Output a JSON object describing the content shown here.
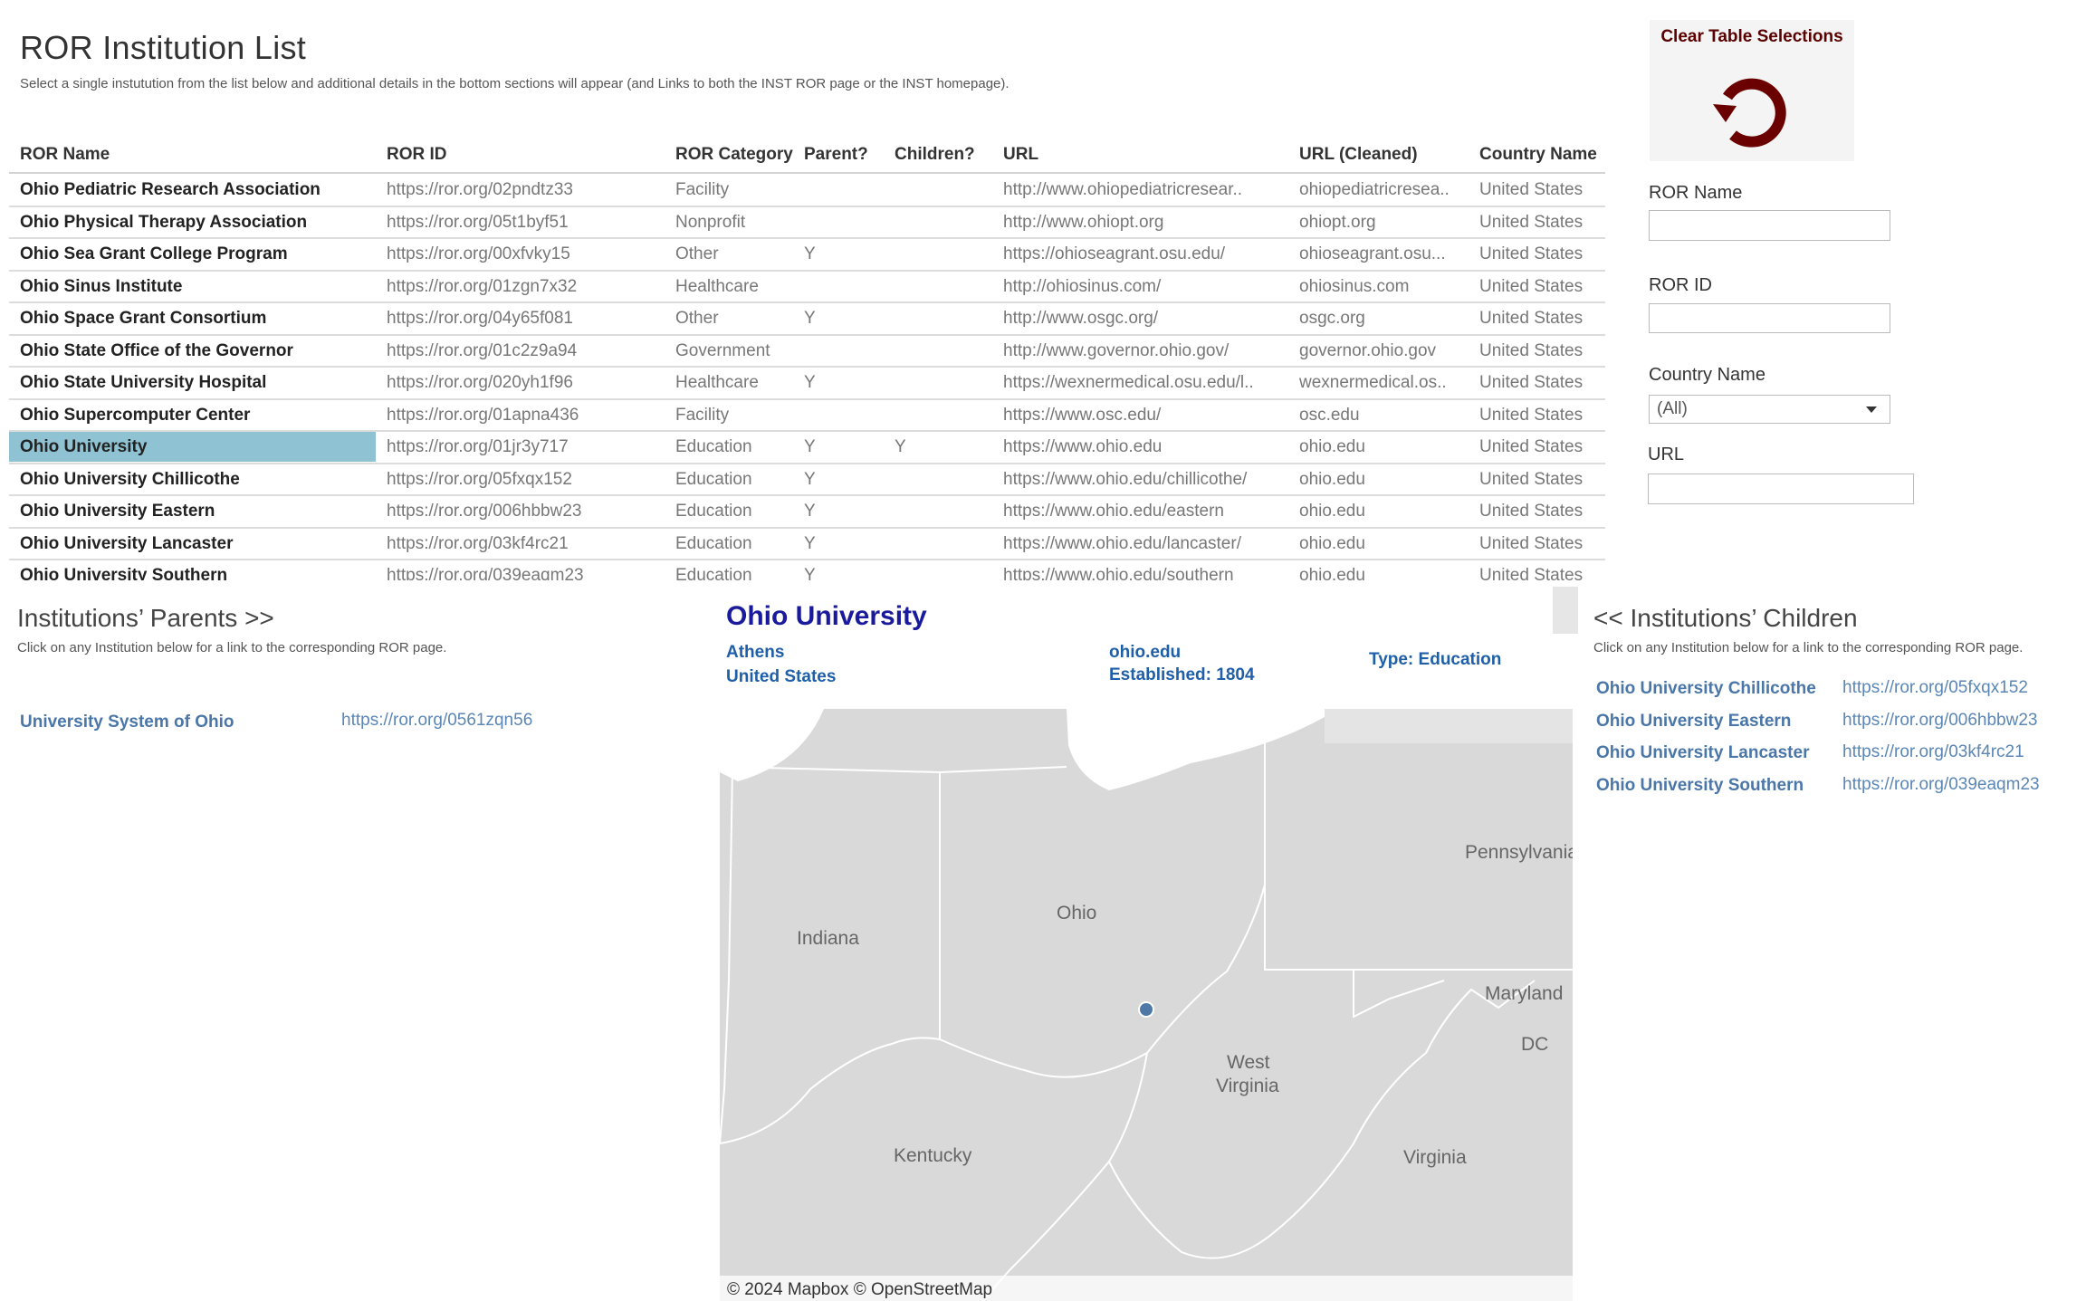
{
  "header": {
    "title": "ROR Institution List",
    "subtitle": "Select a single instutution from the list below and additional details in the bottom sections will appear (and Links to both the INST ROR page or the INST homepage)."
  },
  "table": {
    "columns": [
      "ROR Name",
      "ROR ID",
      "ROR Category",
      "Parent?",
      "Children?",
      "URL",
      "URL (Cleaned)",
      "Country Name"
    ],
    "selected_row": 8,
    "selected_color": "#8fc3d3",
    "rows": [
      [
        "Ohio Pediatric Research Association",
        "https://ror.org/02pndtz33",
        "Facility",
        "",
        "",
        "http://www.ohiopediatricresear..",
        "ohiopediatricresea..",
        "United States"
      ],
      [
        "Ohio Physical Therapy Association",
        "https://ror.org/05t1byf51",
        "Nonprofit",
        "",
        "",
        "http://www.ohiopt.org",
        "ohiopt.org",
        "United States"
      ],
      [
        "Ohio Sea Grant College Program",
        "https://ror.org/00xfvky15",
        "Other",
        "Y",
        "",
        "https://ohioseagrant.osu.edu/",
        "ohioseagrant.osu...",
        "United States"
      ],
      [
        "Ohio Sinus Institute",
        "https://ror.org/01zgn7x32",
        "Healthcare",
        "",
        "",
        "http://ohiosinus.com/",
        "ohiosinus.com",
        "United States"
      ],
      [
        "Ohio Space Grant Consortium",
        "https://ror.org/04y65f081",
        "Other",
        "Y",
        "",
        "http://www.osgc.org/",
        "osgc.org",
        "United States"
      ],
      [
        "Ohio State Office of the Governor",
        "https://ror.org/01c2z9a94",
        "Government",
        "",
        "",
        "http://www.governor.ohio.gov/",
        "governor.ohio.gov",
        "United States"
      ],
      [
        "Ohio State University Hospital",
        "https://ror.org/020yh1f96",
        "Healthcare",
        "Y",
        "",
        "https://wexnermedical.osu.edu/l..",
        "wexnermedical.os..",
        "United States"
      ],
      [
        "Ohio Supercomputer Center",
        "https://ror.org/01apna436",
        "Facility",
        "",
        "",
        "https://www.osc.edu/",
        "osc.edu",
        "United States"
      ],
      [
        "Ohio University",
        "https://ror.org/01jr3y717",
        "Education",
        "Y",
        "Y",
        "https://www.ohio.edu",
        "ohio.edu",
        "United States"
      ],
      [
        "Ohio University Chillicothe",
        "https://ror.org/05fxqx152",
        "Education",
        "Y",
        "",
        "https://www.ohio.edu/chillicothe/",
        "ohio.edu",
        "United States"
      ],
      [
        "Ohio University Eastern",
        "https://ror.org/006hbbw23",
        "Education",
        "Y",
        "",
        "https://www.ohio.edu/eastern",
        "ohio.edu",
        "United States"
      ],
      [
        "Ohio University Lancaster",
        "https://ror.org/03kf4rc21",
        "Education",
        "Y",
        "",
        "https://www.ohio.edu/lancaster/",
        "ohio.edu",
        "United States"
      ],
      [
        "Ohio University Southern",
        "https://ror.org/039eaqm23",
        "Education",
        "Y",
        "",
        "https://www.ohio.edu/southern",
        "ohio.edu",
        "United States"
      ]
    ]
  },
  "filters": {
    "clear_label": "Clear Table Selections",
    "clear_icon": "refresh-icon",
    "clear_color": "#6b0000",
    "ror_name_label": "ROR Name",
    "ror_name_value": "",
    "ror_id_label": "ROR ID",
    "ror_id_value": "",
    "country_label": "Country Name",
    "country_value": "(All)",
    "url_label": "URL",
    "url_value": ""
  },
  "parents": {
    "title": "Institutions’ Parents >>",
    "subtitle": "Click on any Institution below for a link to the corresponding ROR page.",
    "items": [
      {
        "name": "University System of Ohio",
        "url": "https://ror.org/0561zqn56"
      }
    ]
  },
  "detail": {
    "name": "Ohio University",
    "city": "Athens",
    "country": "United States",
    "domain": "ohio.edu",
    "established": "Established: 1804",
    "type": "Type: Education"
  },
  "map": {
    "labels": [
      "Pennsylvania",
      "Ohio",
      "Indiana",
      "West",
      "Virginia",
      "Maryland",
      "DC",
      "Kentucky",
      "Virginia"
    ],
    "attribution": "© 2024 Mapbox  © OpenStreetMap",
    "marker_color": "#4e79a7"
  },
  "children": {
    "title": "<< Institutions’ Children",
    "subtitle": "Click on any Institution below for a link to the corresponding ROR page.",
    "items": [
      {
        "name": "Ohio University Chillicothe",
        "url": "https://ror.org/05fxqx152"
      },
      {
        "name": "Ohio University Eastern",
        "url": "https://ror.org/006hbbw23"
      },
      {
        "name": "Ohio University Lancaster",
        "url": "https://ror.org/03kf4rc21"
      },
      {
        "name": "Ohio University Southern",
        "url": "https://ror.org/039eaqm23"
      }
    ]
  }
}
